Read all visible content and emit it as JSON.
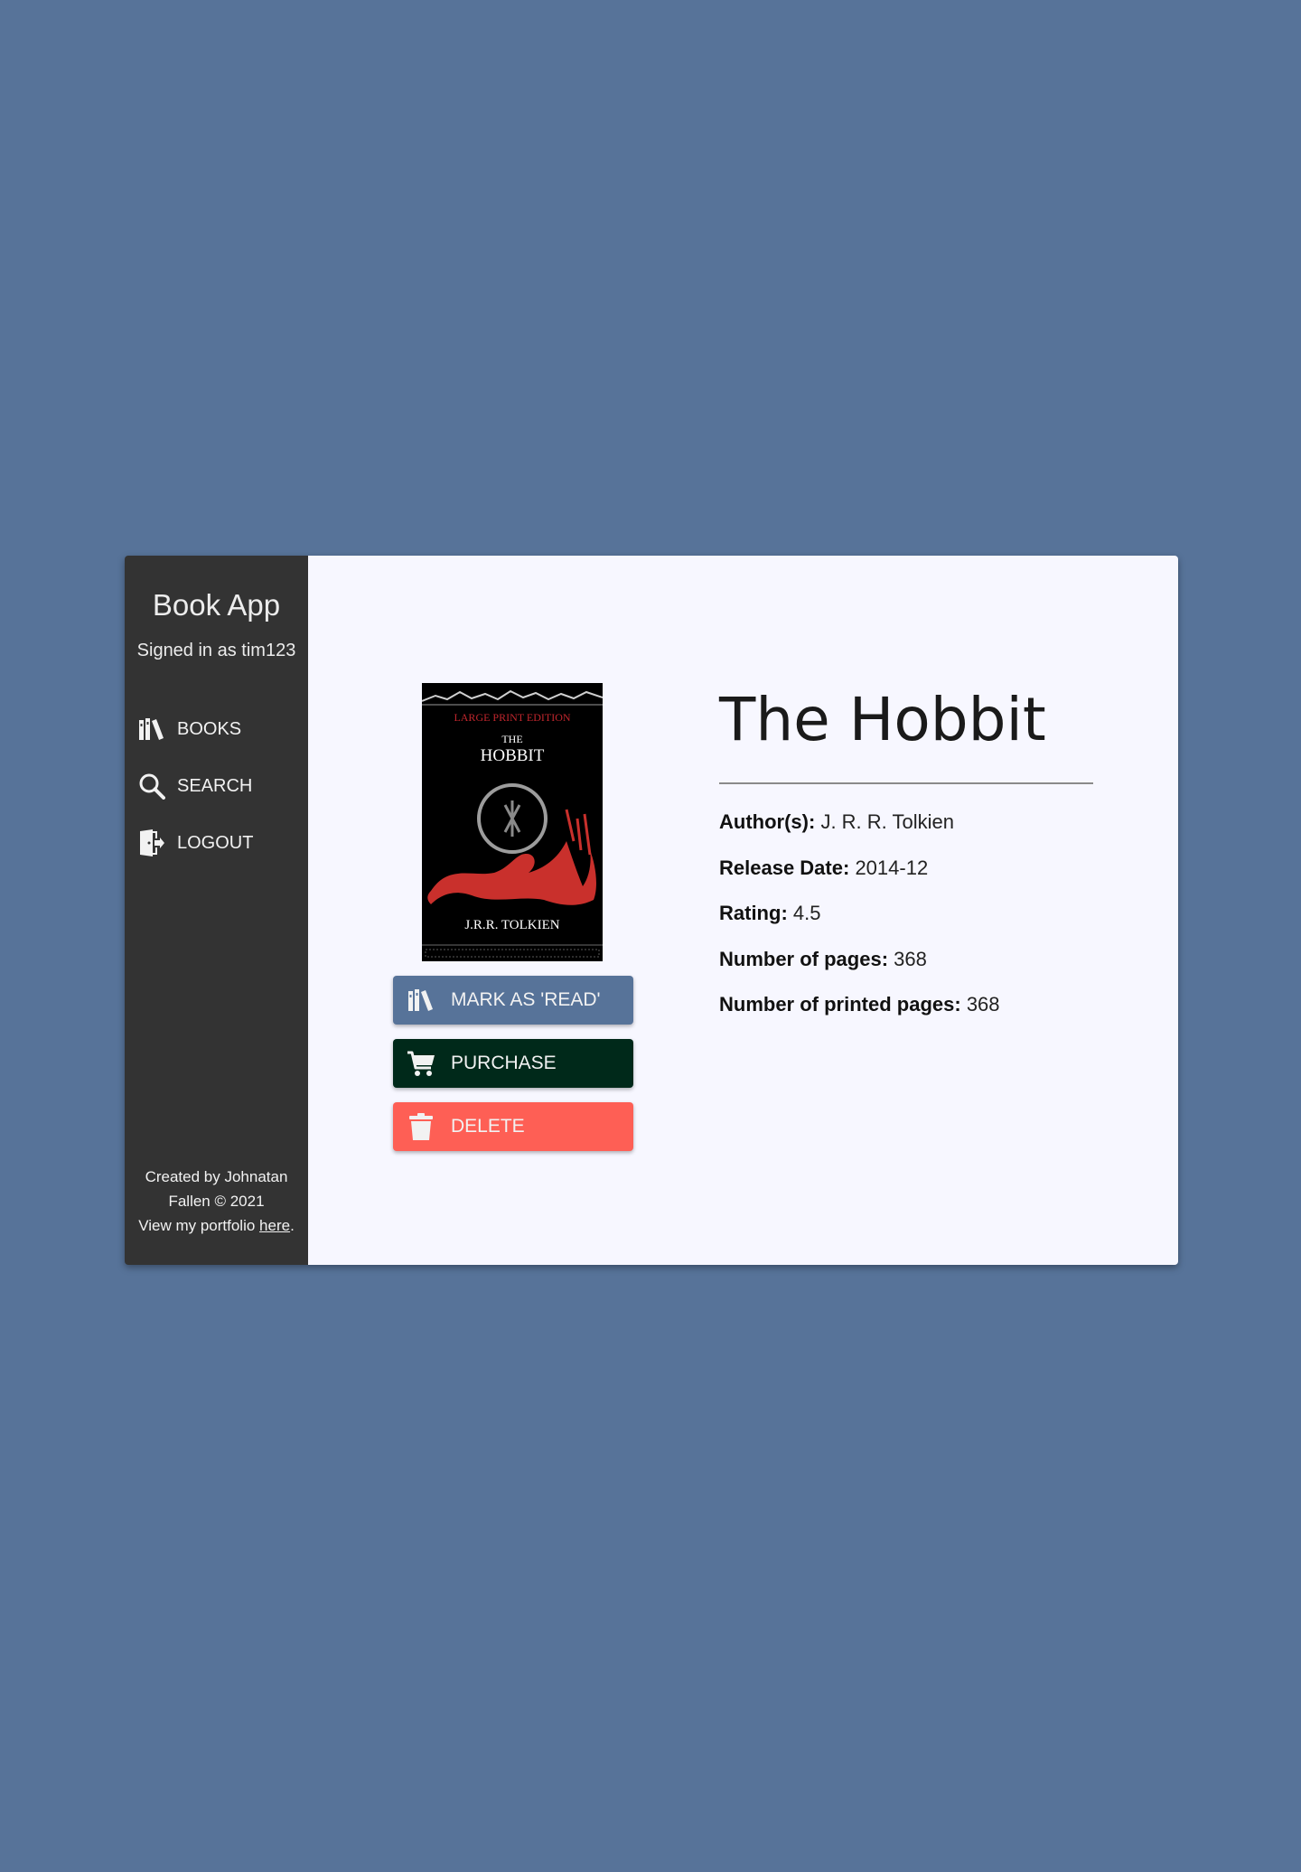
{
  "sidebar": {
    "app_title": "Book App",
    "signed_in": "Signed in as tim123",
    "nav": [
      {
        "label": "BOOKS",
        "icon": "books-icon"
      },
      {
        "label": "SEARCH",
        "icon": "search-icon"
      },
      {
        "label": "LOGOUT",
        "icon": "logout-icon"
      }
    ],
    "footer": {
      "line1": "Created by Johnatan",
      "line2": "Fallen © 2021",
      "line3_prefix": "View my portfolio ",
      "link": "here",
      "line3_suffix": "."
    }
  },
  "book": {
    "title": "The Hobbit",
    "cover": {
      "edition": "LARGE PRINT EDITION",
      "the": "THE",
      "title": "HOBBIT",
      "author": "J.R.R. TOLKIEN"
    },
    "details": [
      {
        "label": "Author(s):",
        "value": "J. R. R. Tolkien"
      },
      {
        "label": "Release Date:",
        "value": "2014-12"
      },
      {
        "label": "Rating:",
        "value": "4.5"
      },
      {
        "label": "Number of pages:",
        "value": "368"
      },
      {
        "label": "Number of printed pages:",
        "value": "368"
      }
    ]
  },
  "actions": {
    "mark_read": "MARK AS 'READ'",
    "purchase": "PURCHASE",
    "delete": "DELETE"
  },
  "colors": {
    "background": "#577399",
    "sidebar": "#333333",
    "main": "#f7f7ff",
    "mark_read": "#577399",
    "purchase": "#00291a",
    "delete": "#fe5f55"
  }
}
